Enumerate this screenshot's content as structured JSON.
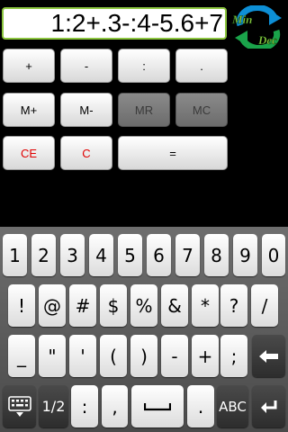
{
  "calculator": {
    "display": "1:2+.3-:4-5.6+7",
    "logo_text": [
      "Min",
      "Dec"
    ],
    "buttons": [
      "+",
      "-",
      ":",
      ".",
      "M+",
      "M-",
      "MR",
      "MC",
      "CE",
      "C",
      "="
    ],
    "colors": {
      "accent": "#8cc63f",
      "logo_blue": "#0d8fd6",
      "red_label": "#e00000"
    }
  },
  "keyboard": {
    "row1": [
      "1",
      "2",
      "3",
      "4",
      "5",
      "6",
      "7",
      "8",
      "9",
      "0"
    ],
    "row2": [
      "!",
      "@",
      "#",
      "$",
      "%",
      "&",
      "*",
      "?",
      "/"
    ],
    "row3": [
      "_",
      "\"",
      "'",
      "(",
      ")",
      "-",
      "+",
      ";"
    ],
    "row4": {
      "layout_toggle": "1/2",
      "left": [
        ":",
        ","
      ],
      "spacebar_icon": "space-icon",
      "right": [
        "."
      ],
      "abc": "ABC"
    },
    "icons": {
      "backspace": "backspace-icon",
      "enter": "enter-icon",
      "settings": "keyboard-settings-icon"
    }
  }
}
